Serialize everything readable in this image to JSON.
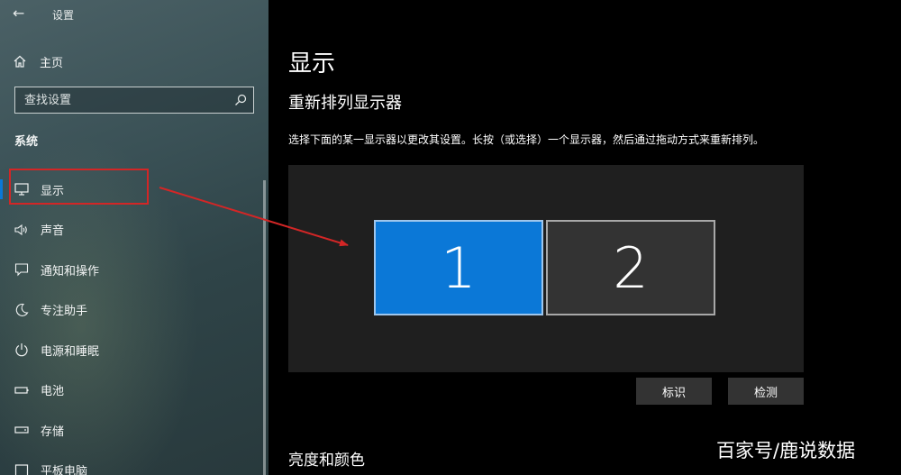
{
  "window": {
    "title": "设置",
    "back_icon": "back-arrow-icon"
  },
  "sidebar": {
    "home_label": "主页",
    "search_placeholder": "查找设置",
    "section_title": "系统",
    "items": [
      {
        "label": "显示",
        "icon": "display-icon",
        "active": true
      },
      {
        "label": "声音",
        "icon": "speaker-icon",
        "active": false
      },
      {
        "label": "通知和操作",
        "icon": "notification-icon",
        "active": false
      },
      {
        "label": "专注助手",
        "icon": "moon-icon",
        "active": false
      },
      {
        "label": "电源和睡眠",
        "icon": "power-icon",
        "active": false
      },
      {
        "label": "电池",
        "icon": "battery-icon",
        "active": false
      },
      {
        "label": "存储",
        "icon": "storage-icon",
        "active": false
      },
      {
        "label": "平板电脑",
        "icon": "tablet-icon",
        "active": false
      }
    ]
  },
  "main": {
    "page_title": "显示",
    "section_title": "重新排列显示器",
    "description": "选择下面的某一显示器以更改其设置。长按（或选择）一个显示器，然后通过拖动方式来重新排列。",
    "monitors": [
      {
        "number": "1",
        "selected": true
      },
      {
        "number": "2",
        "selected": false
      }
    ],
    "identify_label": "标识",
    "detect_label": "检测",
    "brightness_title": "亮度和颜色"
  },
  "watermark": "百家号/鹿说数据",
  "colors": {
    "accent": "#0b78d7",
    "annotation": "#d32626"
  }
}
